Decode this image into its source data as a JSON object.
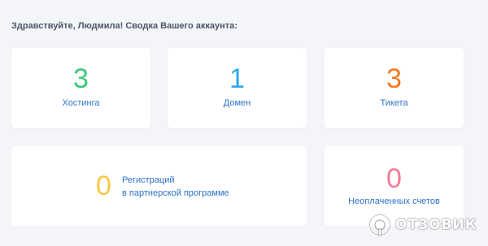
{
  "header": {
    "greeting": "Здравствуйте, Людмила! Сводка Вашего аккаунта:"
  },
  "stats": {
    "hosting": {
      "value": "3",
      "label": "Хостинга",
      "color": "#3bc97a"
    },
    "domain": {
      "value": "1",
      "label": "Домен",
      "color": "#2fa8e8"
    },
    "tickets": {
      "value": "3",
      "label": "Тикета",
      "color": "#f37a21"
    }
  },
  "partner": {
    "value": "0",
    "label_line1": "Регистраций",
    "label_line2": "в партнерской программе",
    "color": "#f6c945"
  },
  "unpaid": {
    "value": "0",
    "label": "Неоплаченных счетов",
    "color": "#f37a94"
  },
  "watermark": {
    "icon": "otzovik-logo-icon",
    "text": "ОТЗОВИК"
  },
  "colors": {
    "background": "#f4f5f9",
    "card": "#ffffff",
    "link_text": "#2b72c8",
    "greeting_text": "#4a5566"
  }
}
